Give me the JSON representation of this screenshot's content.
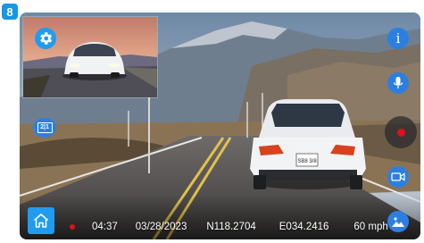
{
  "callout_number": "8",
  "colors": {
    "accent": "#1f9cf0",
    "record_red": "#e0101c",
    "button_blue": "#2c7fe0",
    "callout_blue": "#1696e6"
  },
  "icons": {
    "settings": "gear-icon",
    "info": "info-icon",
    "microphone": "microphone-icon",
    "record": "record-icon",
    "video": "video-camera-icon",
    "photo": "photo-icon",
    "home": "home-icon",
    "camera_switch": "camera-switch-icon"
  },
  "info_label": "i",
  "camera_switch_label": "2|1",
  "plate_text": "SB8 3/8",
  "status_bar": {
    "time": "04:37",
    "date": "03/28/2023",
    "longitude": "N118.2704",
    "latitude": "E034.2416",
    "speed": "60 mph"
  }
}
